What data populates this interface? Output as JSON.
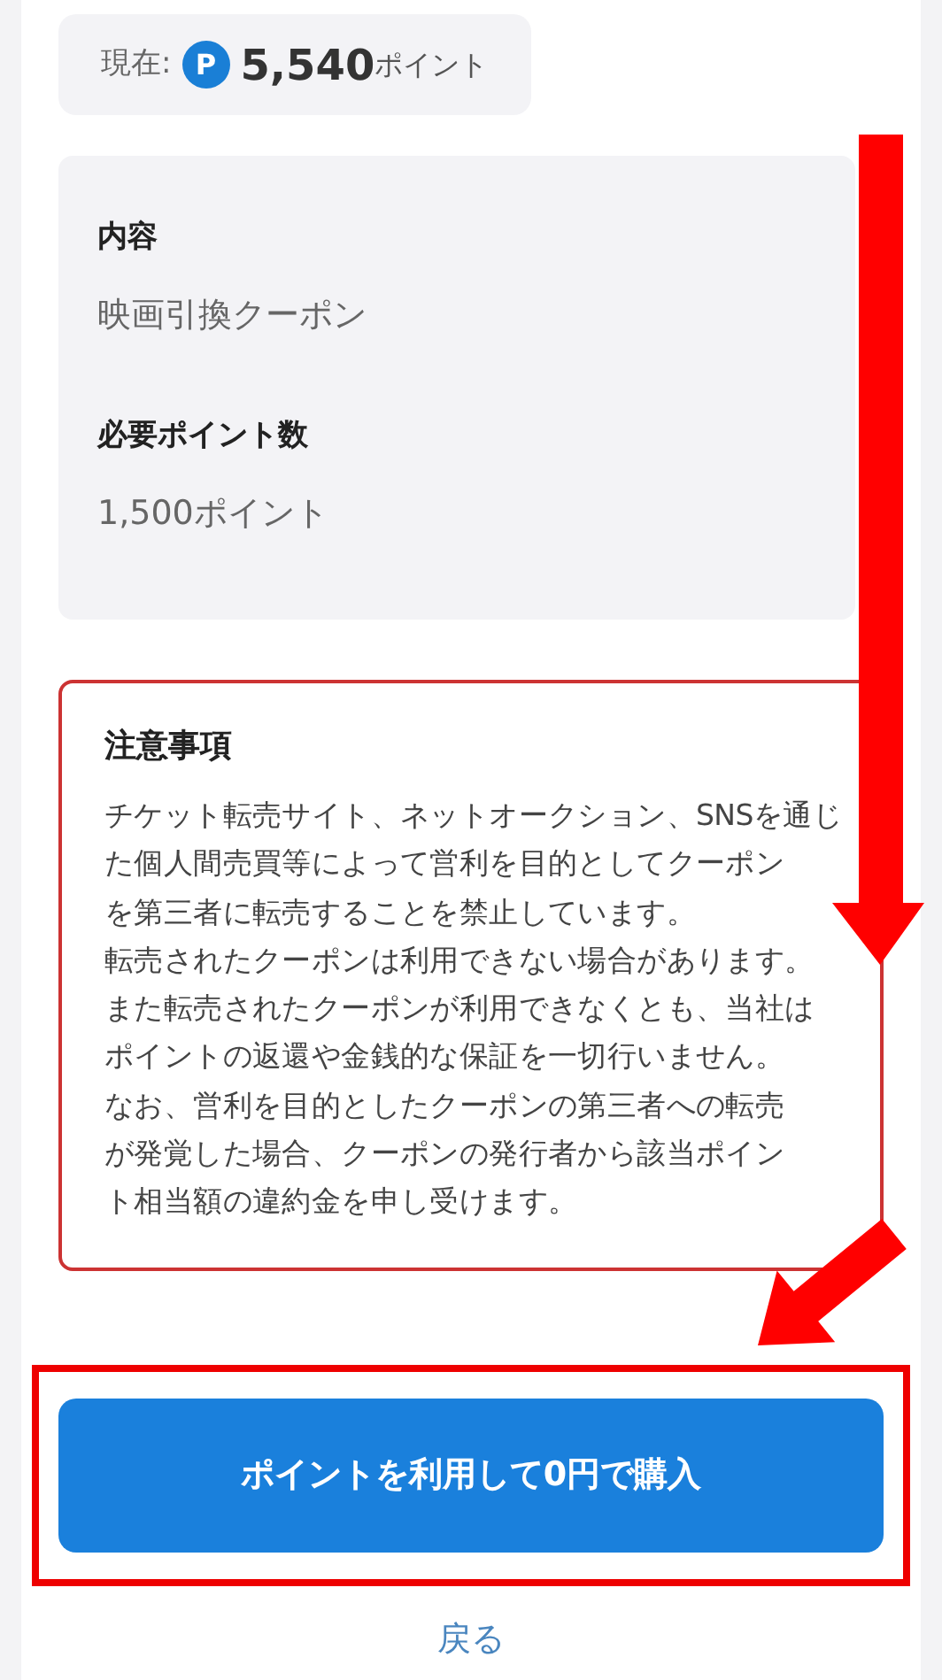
{
  "current_points": {
    "label": "現在:",
    "mark": "P",
    "value": "5,540",
    "unit": "ポイント"
  },
  "details": [
    {
      "heading": "内容",
      "value": "映画引換クーポン"
    },
    {
      "heading": "必要ポイント数",
      "value": "1,500ポイント"
    }
  ],
  "notice": {
    "title": "注意事項",
    "lines": [
      "チケット転売サイト、ネットオークション、SNSを通じ",
      "た個人間売買等によって営利を目的としてクーポン",
      "を第三者に転売することを禁止しています。",
      "転売されたクーポンは利用できない場合があります。",
      "また転売されたクーポンが利用できなくとも、当社は",
      "ポイントの返還や金銭的な保証を一切行いません。",
      "なお、営利を目的としたクーポンの第三者への転売",
      "が発覚した場合、クーポンの発行者から該当ポイン",
      "ト相当額の違約金を申し受けます。"
    ]
  },
  "purchase_button": "ポイントを利用して0円で購入",
  "back_link": "戻る",
  "annotations": [
    {
      "kind": "arrow-down"
    },
    {
      "kind": "arrow-diagonal"
    },
    {
      "kind": "highlight-box"
    }
  ]
}
